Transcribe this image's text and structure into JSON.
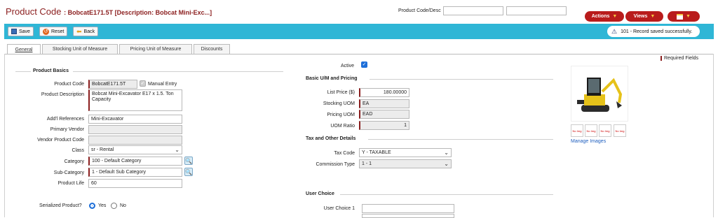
{
  "header": {
    "title": "Product Code",
    "subtitle": ": BobcatE171.5T [Description: Bobcat Mini-Exc...]",
    "search_label": "Product Code/Desc",
    "search_value": "",
    "search_value2": "",
    "actions_label": "Actions",
    "views_label": "Views"
  },
  "toolbar": {
    "save_label": "Save",
    "reset_label": "Reset",
    "back_label": "Back",
    "notice": "101 - Record saved successfully."
  },
  "tabs": [
    {
      "label": "General"
    },
    {
      "label": "Stocking Unit of Measure"
    },
    {
      "label": "Pricing Unit of Measure"
    },
    {
      "label": "Discounts"
    }
  ],
  "required_note": "Required Fields",
  "active": {
    "label": "Active",
    "checked": true
  },
  "basics": {
    "title": "Product Basics",
    "product_code_label": "Product Code",
    "product_code": "BobcatE171.5T",
    "manual_entry_label": "Manual Entry",
    "description_label": "Product Description",
    "description": "Bobcat Mini-Excavator E17 x 1.5. Ton Capacity",
    "refs_label": "Add'l References",
    "refs": "Mini-Excavator",
    "primary_vendor_label": "Primary Vendor",
    "primary_vendor": "",
    "vendor_code_label": "Vendor Product Code",
    "vendor_code": "",
    "class_label": "Class",
    "class": "sr - Rental",
    "category_label": "Category",
    "category": "100 - Default Category",
    "subcategory_label": "Sub-Category",
    "subcategory": "1 - Default Sub Category",
    "life_label": "Product Life",
    "life": "60",
    "serialized_label": "Serialized Product?",
    "yes_label": "Yes",
    "no_label": "No",
    "serialized": "Yes"
  },
  "pricing": {
    "title": "Basic U/M and Pricing",
    "list_price_label": "List Price ($)",
    "list_price": "180.00000",
    "stocking_uom_label": "Stocking UOM",
    "stocking_uom": "EA",
    "pricing_uom_label": "Pricing UOM",
    "pricing_uom": "EAD",
    "uom_ratio_label": "UOM Ratio",
    "uom_ratio": "1"
  },
  "tax": {
    "title": "Tax and Other Details",
    "tax_code_label": "Tax Code",
    "tax_code": "Y - TAXABLE",
    "commission_label": "Commission Type",
    "commission": "1 - 1"
  },
  "user_choice": {
    "title": "User Choice",
    "choice1_label": "User Choice 1",
    "choice1": ""
  },
  "images": {
    "manage_label": "Manage Images",
    "thumb_labels": [
      "No Img",
      "No Img",
      "No Img",
      "No Img"
    ]
  },
  "colors": {
    "brand_red": "#b91c1c",
    "title_red": "#8b1e1e",
    "toolbar_blue": "#2fb6d6"
  }
}
